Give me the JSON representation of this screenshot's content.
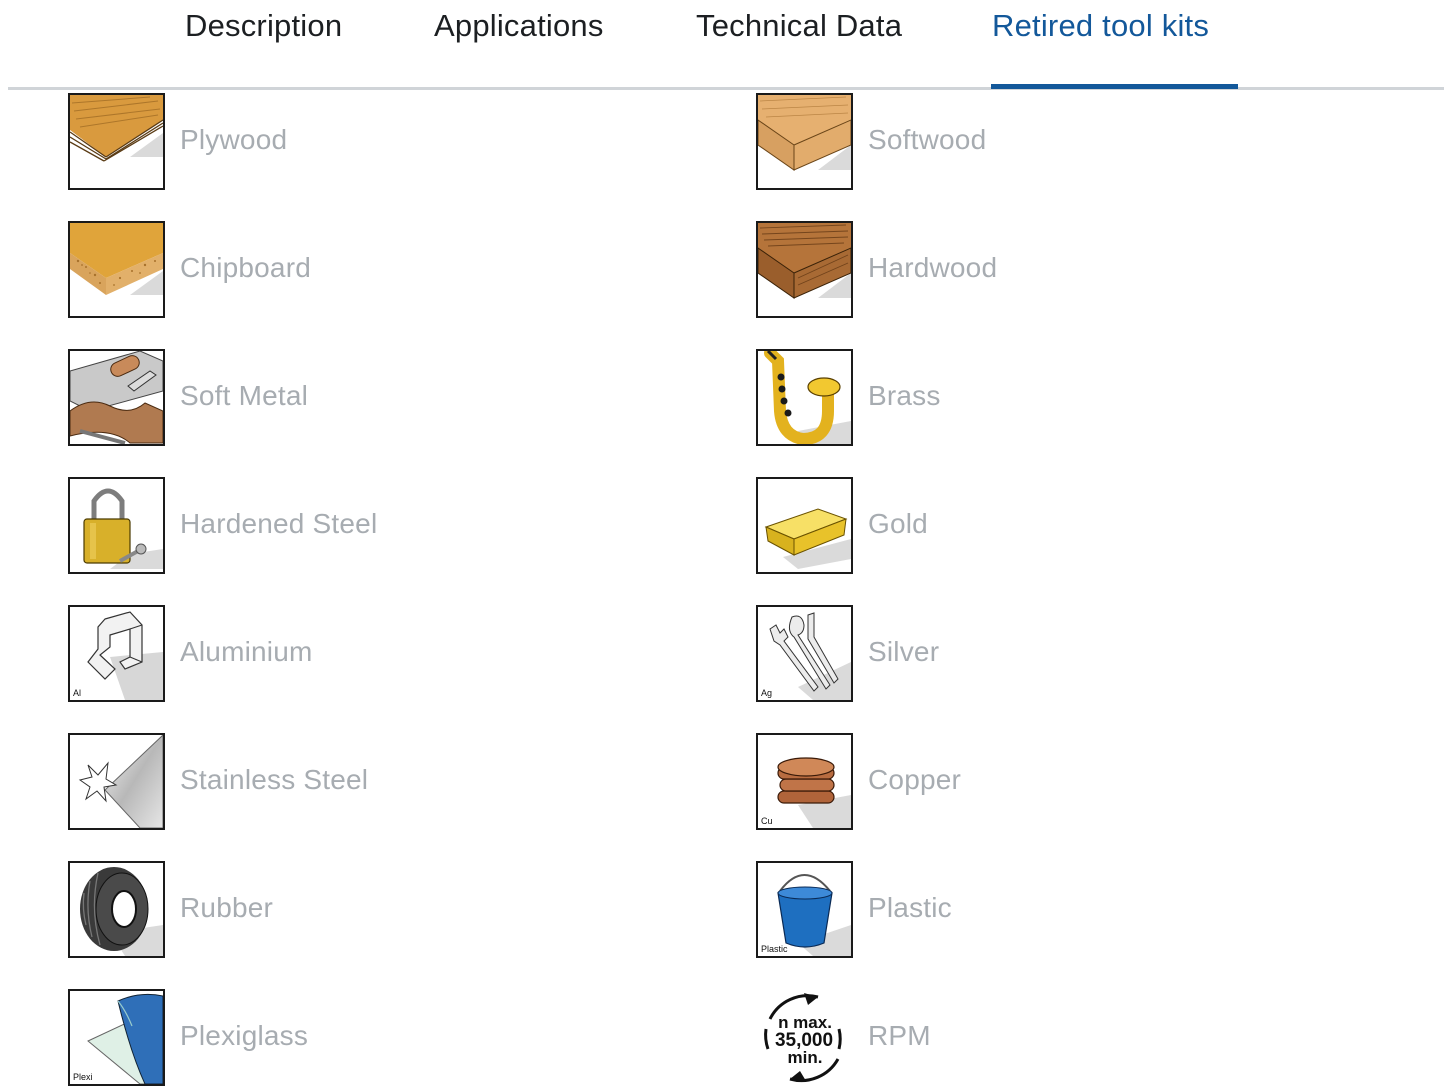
{
  "tabs": [
    {
      "label": "Description"
    },
    {
      "label": "Applications"
    },
    {
      "label": "Technical Data"
    },
    {
      "label": "Retired tool kits"
    }
  ],
  "active_tab": "Retired tool kits",
  "materials_left": [
    {
      "label": "Plywood",
      "icon": "plywood-icon"
    },
    {
      "label": "Chipboard",
      "icon": "chipboard-icon"
    },
    {
      "label": "Soft Metal",
      "icon": "soft-metal-icon"
    },
    {
      "label": "Hardened Steel",
      "icon": "padlock-icon"
    },
    {
      "label": "Aluminium",
      "icon": "aluminium-profile-icon",
      "symbol": "Al"
    },
    {
      "label": "Stainless Steel",
      "icon": "stainless-steel-sheet-icon"
    },
    {
      "label": "Rubber",
      "icon": "tire-icon"
    },
    {
      "label": "Plexiglass",
      "icon": "plexiglass-sheet-icon",
      "symbol": "Plexi"
    }
  ],
  "materials_right": [
    {
      "label": "Softwood",
      "icon": "softwood-icon"
    },
    {
      "label": "Hardwood",
      "icon": "hardwood-icon"
    },
    {
      "label": "Brass",
      "icon": "saxophone-icon"
    },
    {
      "label": "Gold",
      "icon": "gold-bar-icon"
    },
    {
      "label": "Silver",
      "icon": "cutlery-icon",
      "symbol": "Ag"
    },
    {
      "label": "Copper",
      "icon": "coins-icon",
      "symbol": "Cu"
    },
    {
      "label": "Plastic",
      "icon": "bucket-icon",
      "symbol": "Plastic"
    },
    {
      "label": "RPM",
      "icon": "rpm-icon",
      "rpm_text": [
        "n max.",
        "35,000",
        "min."
      ]
    }
  ],
  "colors": {
    "accent": "#13589a",
    "label": "#a7acb1",
    "tab_text": "#1c1f22"
  }
}
